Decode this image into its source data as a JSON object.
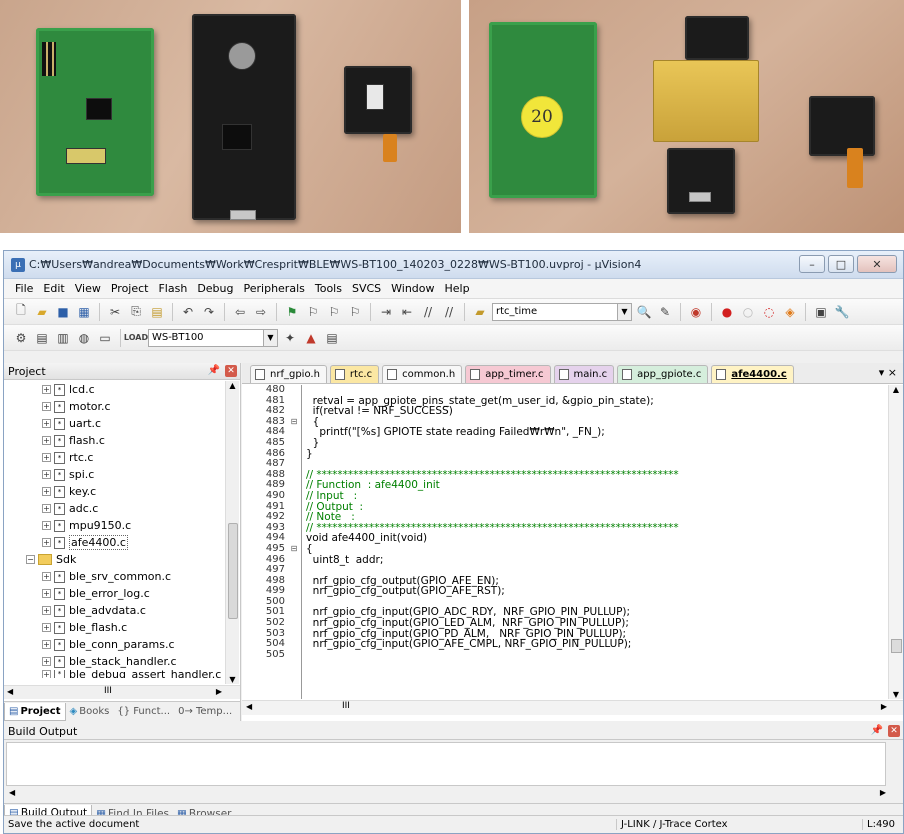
{
  "photos": {
    "coin_label": "20"
  },
  "window": {
    "title": "C:₩Users₩andrea₩Documents₩Work₩Cresprit₩BLE₩WS-BT100_140203_0228₩WS-BT100.uvproj - µVision4",
    "minimize": "–",
    "maximize": "□",
    "close": "✕"
  },
  "menu": [
    "File",
    "Edit",
    "View",
    "Project",
    "Flash",
    "Debug",
    "Peripherals",
    "Tools",
    "SVCS",
    "Window",
    "Help"
  ],
  "toolbar": {
    "find_combo": "rtc_time",
    "target_combo": "WS-BT100"
  },
  "project": {
    "title": "Project",
    "files": [
      "lcd.c",
      "motor.c",
      "uart.c",
      "flash.c",
      "rtc.c",
      "spi.c",
      "key.c",
      "adc.c",
      "mpu9150.c",
      "afe4400.c"
    ],
    "folder": "Sdk",
    "sdk_files": [
      "ble_srv_common.c",
      "ble_error_log.c",
      "ble_advdata.c",
      "ble_flash.c",
      "ble_conn_params.c",
      "ble_stack_handler.c",
      "ble_debug_assert_handler.c"
    ],
    "tabs": [
      "Project",
      "Books",
      "{} Funct...",
      "0→ Temp..."
    ],
    "hscroll_label": "III"
  },
  "editor": {
    "tabs": [
      {
        "label": "nrf_gpio.h",
        "color": "#f7f7f7"
      },
      {
        "label": "rtc.c",
        "color": "#fbe7a3"
      },
      {
        "label": "common.h",
        "color": "#f7f7f7"
      },
      {
        "label": "app_timer.c",
        "color": "#f6c9d3"
      },
      {
        "label": "main.c",
        "color": "#e5d2ec"
      },
      {
        "label": "app_gpiote.c",
        "color": "#d5eedc"
      },
      {
        "label": "afe4400.c",
        "color": "#fff3c4"
      }
    ],
    "tab_controls": "▾ ×",
    "lines": [
      {
        "n": "480",
        "f": "",
        "t": "",
        "c": ""
      },
      {
        "n": "481",
        "f": "",
        "t": "  retval = app_gpiote_pins_state_get(m_user_id, &gpio_pin_state);",
        "c": ""
      },
      {
        "n": "482",
        "f": "",
        "t": "  if(retval != NRF_SUCCESS)",
        "c": ""
      },
      {
        "n": "483",
        "f": "⊟",
        "t": "  {",
        "c": ""
      },
      {
        "n": "484",
        "f": "",
        "t": "    printf(\"[%s] GPIOTE state reading Failed₩r₩n\", _FN_);",
        "c": ""
      },
      {
        "n": "485",
        "f": "",
        "t": "  }",
        "c": ""
      },
      {
        "n": "486",
        "f": "",
        "t": "}",
        "c": ""
      },
      {
        "n": "487",
        "f": "",
        "t": "",
        "c": ""
      },
      {
        "n": "488",
        "f": "",
        "t": "// *********************************************************************",
        "c": "comment"
      },
      {
        "n": "489",
        "f": "",
        "t": "// Function  : afe4400_init",
        "c": "comment"
      },
      {
        "n": "490",
        "f": "",
        "t": "// Input   :",
        "c": "comment"
      },
      {
        "n": "491",
        "f": "",
        "t": "// Output  :",
        "c": "comment"
      },
      {
        "n": "492",
        "f": "",
        "t": "// Note   :",
        "c": "comment"
      },
      {
        "n": "493",
        "f": "",
        "t": "// *********************************************************************",
        "c": "comment"
      },
      {
        "n": "494",
        "f": "",
        "t": "void afe4400_init(void)",
        "c": "kw"
      },
      {
        "n": "495",
        "f": "⊟",
        "t": "{",
        "c": ""
      },
      {
        "n": "496",
        "f": "",
        "t": "  uint8_t  addr;",
        "c": ""
      },
      {
        "n": "497",
        "f": "",
        "t": "",
        "c": ""
      },
      {
        "n": "498",
        "f": "",
        "t": "  nrf_gpio_cfg_output(GPIO_AFE_EN);",
        "c": ""
      },
      {
        "n": "499",
        "f": "",
        "t": "  nrf_gpio_cfg_output(GPIO_AFE_RST);",
        "c": ""
      },
      {
        "n": "500",
        "f": "",
        "t": "",
        "c": ""
      },
      {
        "n": "501",
        "f": "",
        "t": "  nrf_gpio_cfg_input(GPIO_ADC_RDY,  NRF_GPIO_PIN_PULLUP);",
        "c": ""
      },
      {
        "n": "502",
        "f": "",
        "t": "  nrf_gpio_cfg_input(GPIO_LED_ALM,  NRF_GPIO_PIN_PULLUP);",
        "c": ""
      },
      {
        "n": "503",
        "f": "",
        "t": "  nrf_gpio_cfg_input(GPIO_PD_ALM,   NRF_GPIO_PIN_PULLUP);",
        "c": ""
      },
      {
        "n": "504",
        "f": "",
        "t": "  nrf_gpio_cfg_input(GPIO_AFE_CMPL, NRF_GPIO_PIN_PULLUP);",
        "c": ""
      },
      {
        "n": "505",
        "f": "",
        "t": "",
        "c": ""
      }
    ],
    "hscroll_label": "III"
  },
  "build": {
    "title": "Build Output",
    "tabs": [
      "Build Output",
      "Find In Files",
      "Browser"
    ]
  },
  "status": {
    "message": "Save the active document",
    "debugger": "J-LINK / J-Trace Cortex",
    "position": "L:490"
  }
}
